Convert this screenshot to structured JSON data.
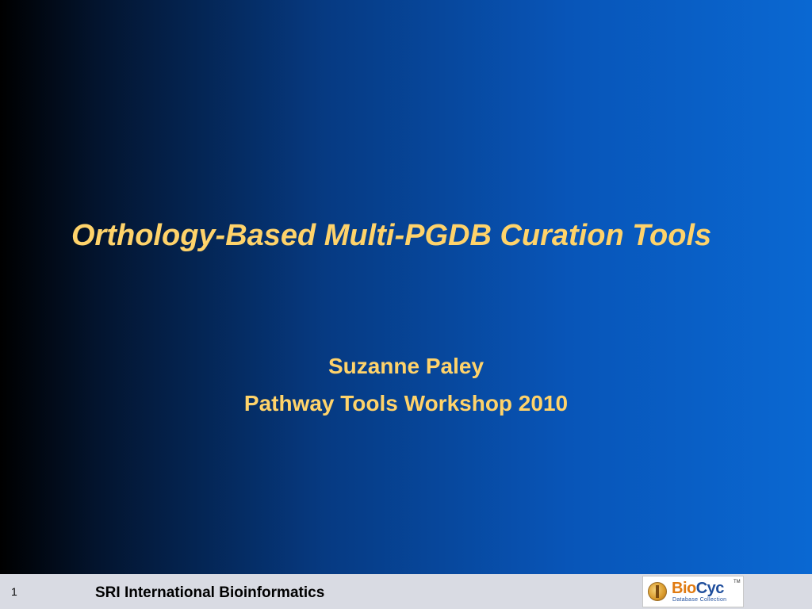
{
  "slide": {
    "title": "Orthology-Based Multi-PGDB Curation Tools",
    "author": "Suzanne Paley",
    "event": "Pathway Tools Workshop 2010"
  },
  "footer": {
    "page_number": "1",
    "organization": "SRI International Bioinformatics",
    "logo": {
      "bio": "Bio",
      "cyc": "Cyc",
      "tm": "TM",
      "subtitle": "Database Collection"
    }
  },
  "colors": {
    "title_text": "#ffd36a",
    "background_dark": "#000000",
    "background_light": "#0a68d2",
    "footer_bg": "#d9dbe3"
  }
}
